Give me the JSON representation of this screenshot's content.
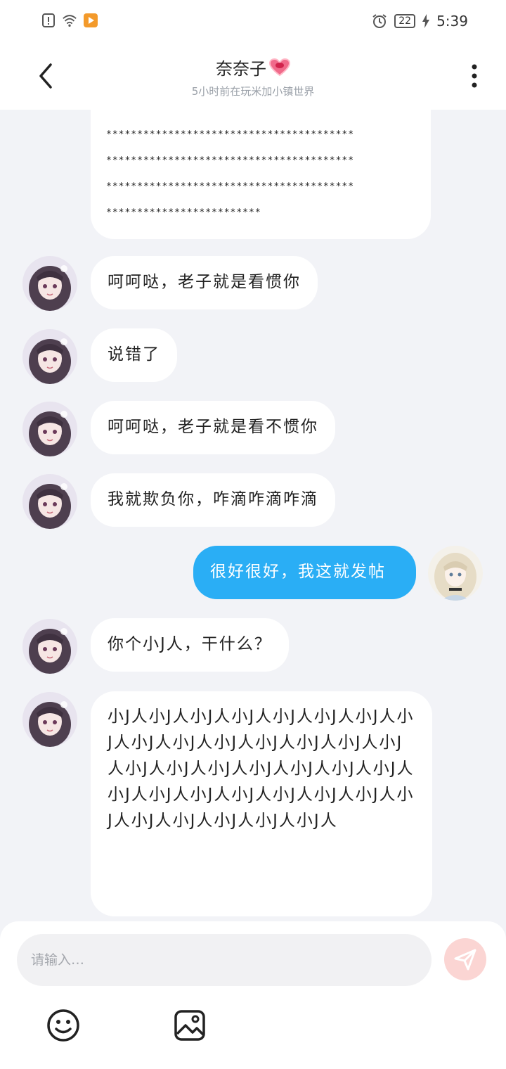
{
  "status_bar": {
    "time": "5:39",
    "battery": "22",
    "icons": [
      "alert-icon",
      "wifi-icon",
      "app-notification-icon",
      "alarm-icon",
      "battery-icon",
      "charging-icon"
    ]
  },
  "header": {
    "title": "奈奈子",
    "subtitle": "5小时前在玩米加小镇世界",
    "back_icon": "chevron-left-icon",
    "menu_icon": "more-vertical-icon",
    "heart_icon": "heart-icon"
  },
  "messages": [
    {
      "from": "other",
      "text": "****************************************\n****************************************\n****************************************\n****************************************\n*************************"
    },
    {
      "from": "other",
      "text": "呵呵哒，老子就是看惯你"
    },
    {
      "from": "other",
      "text": "说错了"
    },
    {
      "from": "other",
      "text": "呵呵哒，老子就是看不惯你"
    },
    {
      "from": "other",
      "text": "我就欺负你，咋滴咋滴咋滴"
    },
    {
      "from": "me",
      "text": "很好很好，我这就发帖"
    },
    {
      "from": "other",
      "text": "你个小J人，干什么？"
    },
    {
      "from": "other",
      "text": "小J人小J人小J人小J人小J人小J人小J人小J人小J人小J人小J人小J人小J人小J人小J人小J人小J人小J人小J人小J人小J人小J人小J人小J人小J人小J人小J人小J人小J人小J人小J人小J人小J人小J人小J人"
    }
  ],
  "input": {
    "placeholder": "请输入…",
    "value": ""
  },
  "toolbar": {
    "send_icon": "send-icon",
    "emoji_icon": "emoji-icon",
    "image_icon": "image-icon"
  },
  "colors": {
    "my_bubble": "#2aaef5",
    "other_bubble": "#ffffff",
    "background": "#f2f3f7",
    "send_button": "#fbd5d3"
  }
}
